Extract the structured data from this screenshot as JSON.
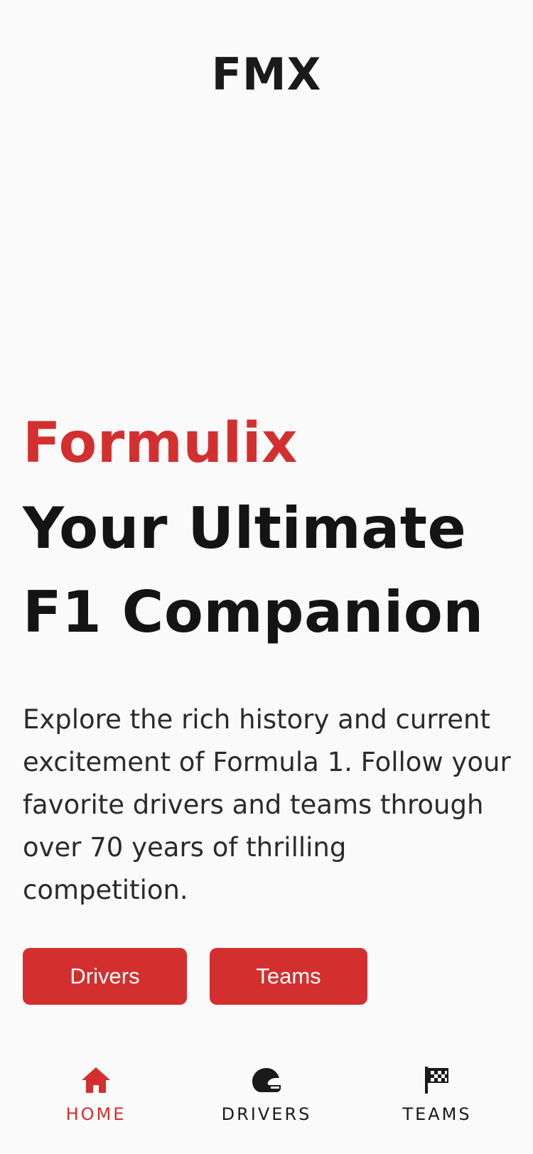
{
  "header": {
    "app_title": "FMX"
  },
  "hero": {
    "brand": "Formulix",
    "headline_line1": "Your Ultimate",
    "headline_line2": "F1 Companion",
    "description": "Explore the rich history and current excitement of Formula 1. Follow your favorite drivers and teams through over 70 years of thrilling competition."
  },
  "actions": {
    "drivers_label": "Drivers",
    "teams_label": "Teams"
  },
  "tabbar": {
    "items": [
      {
        "label": "HOME",
        "icon": "home-icon",
        "active": true
      },
      {
        "label": "DRIVERS",
        "icon": "helmet-icon",
        "active": false
      },
      {
        "label": "TEAMS",
        "icon": "checkered-flag-icon",
        "active": false
      }
    ]
  },
  "colors": {
    "accent": "#d32f2f",
    "background": "#fafafa",
    "text": "#1a1a1a"
  }
}
